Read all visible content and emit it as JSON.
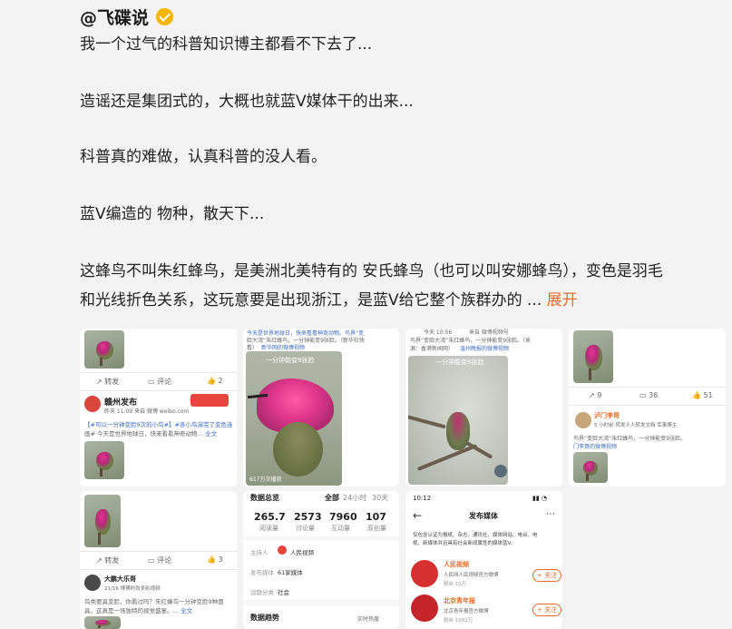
{
  "author": {
    "name": "@飞碟说"
  },
  "body": {
    "lines": [
      "我一个过气的科普知识博主都看不下去了...",
      "造谣还是集团式的，大概也就蓝V媒体干的出来...",
      "科普真的难做，认真科普的没人看。",
      "蓝V编造的 物种，散天下...",
      "这蜂鸟不叫朱红蜂鸟，是美洲北美特有的 安氏蜂鸟（也可以叫安娜蜂鸟），变色是羽毛",
      "和光线折色关系，这玩意要是出现浙江，是蓝V给它整个族群办的 ..."
    ],
    "expand": "展开"
  },
  "thumbs": {
    "t1": {
      "actions": [
        "转发",
        "评论",
        "2"
      ],
      "poster": "赣州发布",
      "meta": "昨天 11:09  来自 微博 weibo.com",
      "text1": "【#可以一分钟变脸9次的小鸟#】#各小鸟演完了变色连",
      "text2": "画# 今天是世界地球日，快来看看神奇动物…",
      "more": "全文"
    },
    "t2": {
      "headline1": "今天是世界地球日，快来看看神奇动物。鸟界“变",
      "headline2": "脸大湾”朱红蜂鸟，一分钟能变9张脸。（新华社快",
      "headline3": "看）",
      "link": "新华网的微博视频",
      "overlay": "一分钟能变9张脸",
      "caption": "617万次播放"
    },
    "t3": {
      "time": "今天 10:56",
      "src": "来自 微博视频号",
      "headline1": "鸟界“变脸大湾”朱红蜂鸟，一分钟能变9张脸。（来",
      "headline2": "源：香港新闻网）",
      "link": "温州晚报的微博视频",
      "overlay": "一分钟能变9张脸"
    },
    "t4": {
      "stats": [
        "9",
        "36",
        "51"
      ],
      "poster": "泸门李哥",
      "meta": "5 小时前  转发人人转发文档  军事博主",
      "text1": "鸟界“变脸大湾”朱红蜂鸟，一分钟能变9张脸。",
      "link": "门李哥的微博视频"
    },
    "t5": {
      "actions": [
        "转发",
        "评论",
        "3"
      ],
      "poster": "大鹏大乐哥",
      "meta": "21/16  博博时尚多彩视频",
      "text1": "鸟类要具变脸，你看过吗？朱红蜂鸟一分钟变脸9种面",
      "text2": "具，这真是一场独特的视觉盛宴。…",
      "more": "全文"
    },
    "t6": {
      "title": "数据总览",
      "tabs": [
        "全部",
        "24小时",
        "30天"
      ],
      "stats": [
        {
          "value": "265.7",
          "label": "阅读量"
        },
        {
          "value": "2573",
          "label": "讨论量"
        },
        {
          "value": "7960",
          "label": "互动量"
        },
        {
          "value": "107",
          "label": "原创量"
        }
      ],
      "host_label": "主持人",
      "host_value": "人民视频",
      "pub_label": "发布媒体",
      "pub_value": "61家媒体",
      "cat_label": "话题分类",
      "cat_value": "社会",
      "trend": "数据趋势",
      "trend_right": "实时热度"
    },
    "t7": {
      "clock": "10:12",
      "title": "发布媒体",
      "note1": "仅包含认证为报纸、杂志、通讯社、媒体网站、电台、电",
      "note2": "视、新媒体并且具有社会新闻属性的媒体蓝V。",
      "media": [
        {
          "name": "人民视频",
          "desc": "人民网人民视频官方微博",
          "stat": "粉丝 10万"
        },
        {
          "name": "北京青年报",
          "desc": "北京青年报官方微博",
          "stat": "粉丝 1002万"
        }
      ],
      "follow": "+ 关注"
    }
  }
}
